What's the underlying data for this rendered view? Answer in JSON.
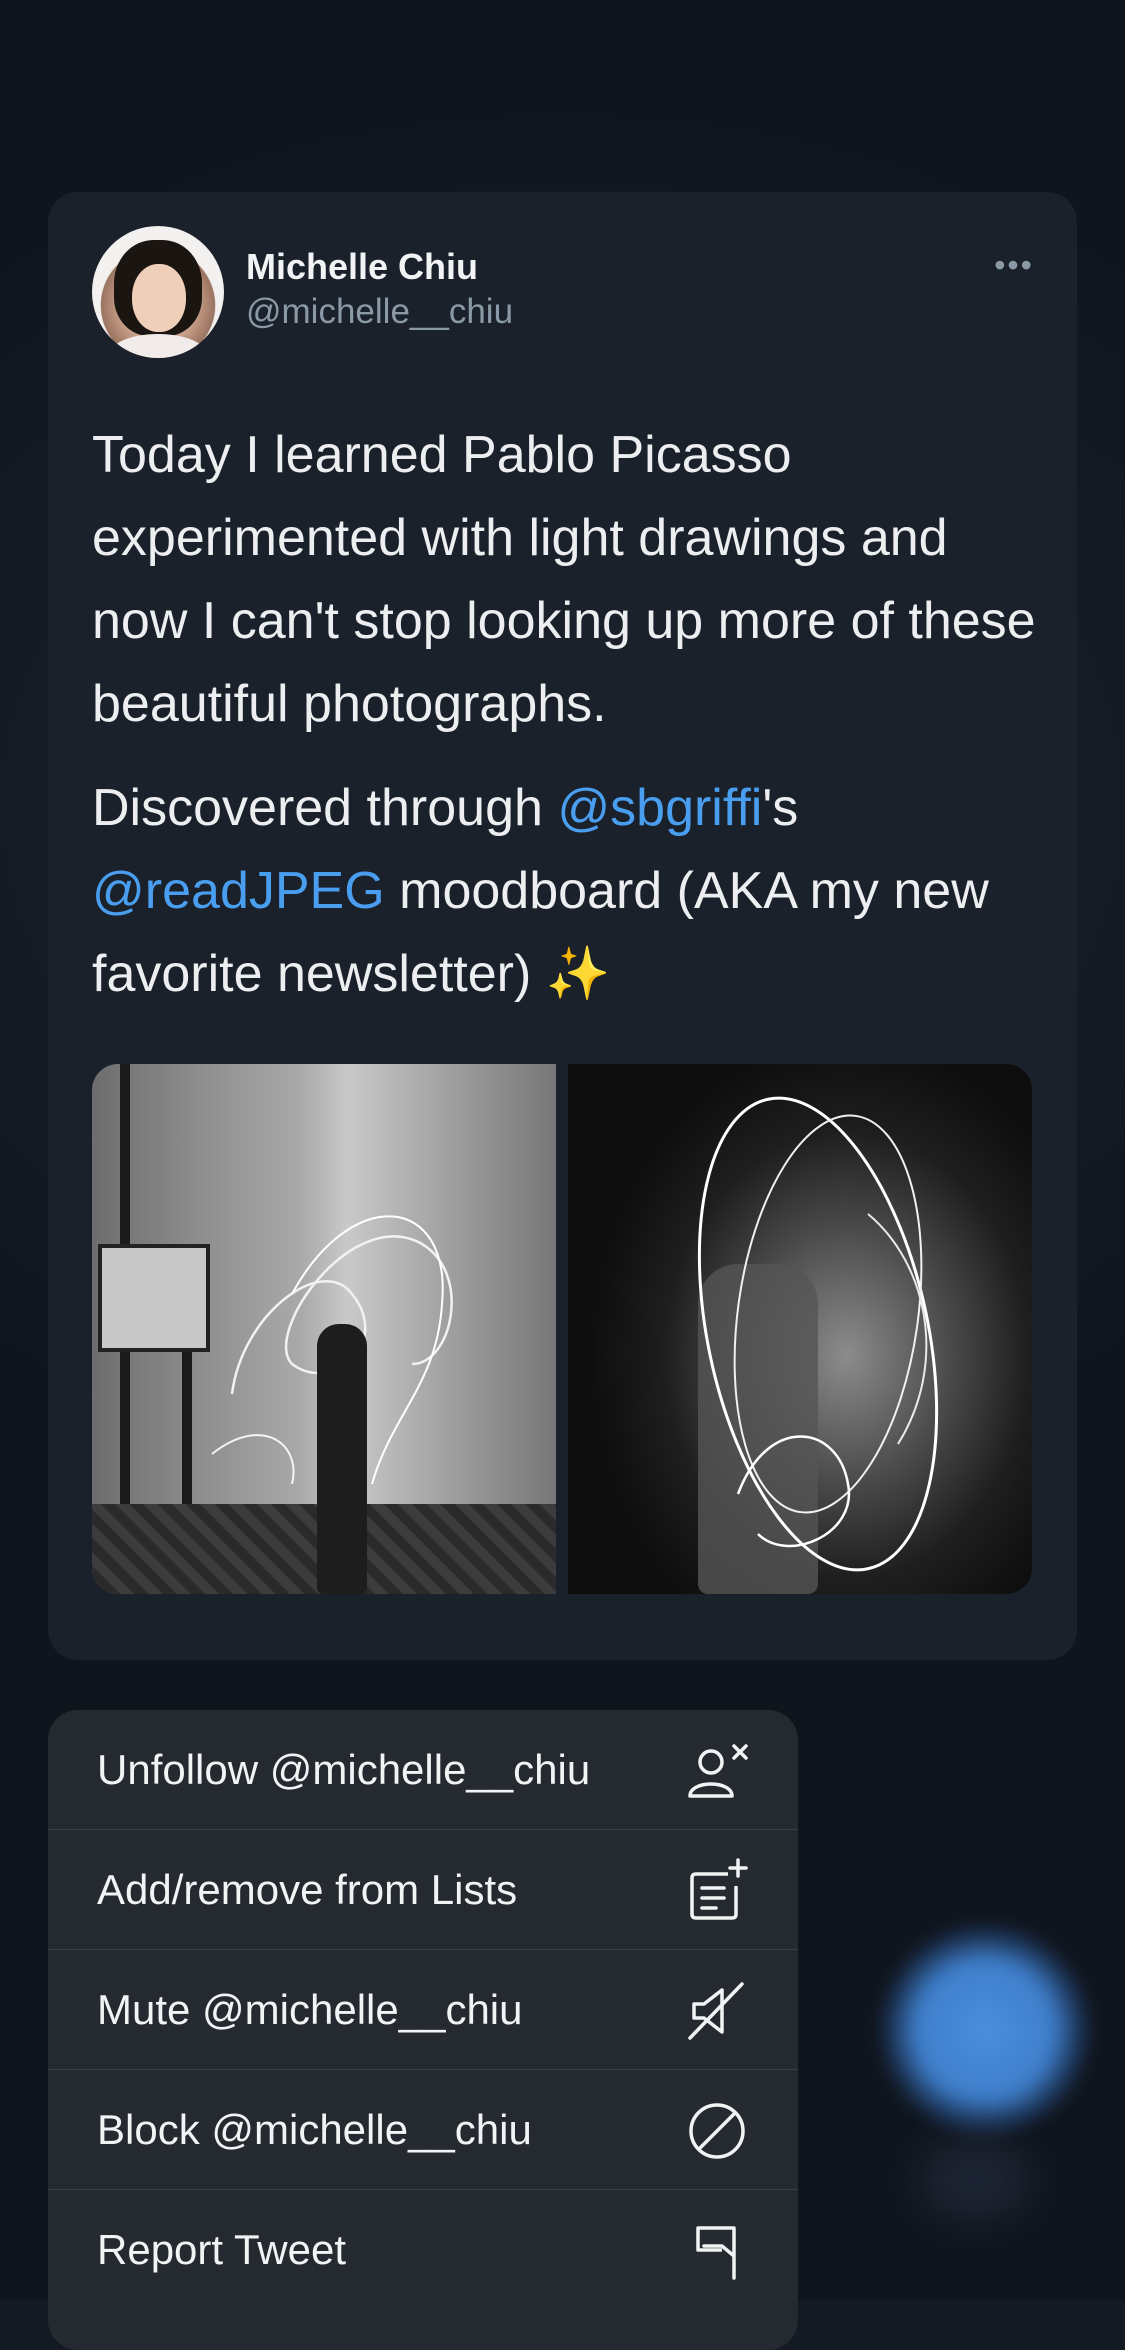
{
  "tweet": {
    "author_name": "Michelle Chiu",
    "author_handle": "@michelle__chiu",
    "more_icon": "more-horizontal-icon",
    "paragraph1": "Today I learned Pablo Picasso experimented with light drawings and now I can't stop looking up more of these beautiful photographs.",
    "paragraph2": {
      "prefix": "Discovered through ",
      "mention1": "@sbgriffi",
      "mid": "'s",
      "mention2": "@readJPEG",
      "suffix": " moodboard (AKA my new favorite newsletter) ✨"
    },
    "media": [
      "photo-picasso-light-drawing-studio",
      "photo-picasso-light-drawing-circle"
    ]
  },
  "menu": {
    "items": [
      {
        "label": "Unfollow @michelle__chiu",
        "icon": "unfollow-user-icon"
      },
      {
        "label": "Add/remove from Lists",
        "icon": "list-add-icon"
      },
      {
        "label": "Mute @michelle__chiu",
        "icon": "mute-icon"
      },
      {
        "label": "Block @michelle__chiu",
        "icon": "block-icon"
      },
      {
        "label": "Report Tweet",
        "icon": "flag-icon"
      }
    ]
  },
  "colors": {
    "background": "#141a24",
    "card": "#1a212b",
    "menu": "#252a31",
    "accent_link": "#4a9ef0",
    "glow": "#4b8fdc"
  }
}
